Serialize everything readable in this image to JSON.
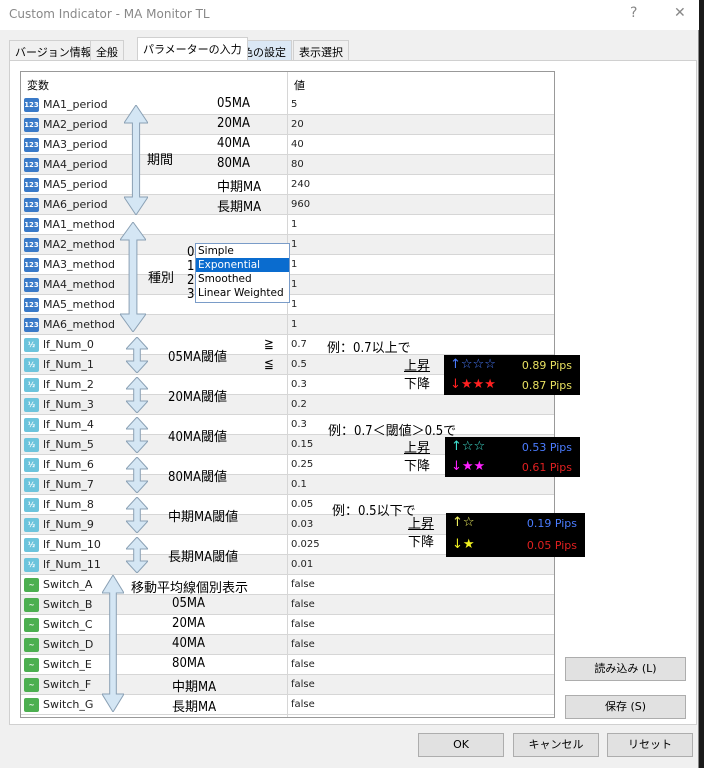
{
  "window": {
    "title": "Custom Indicator - MA Monitor TL",
    "help": "?",
    "close": "✕"
  },
  "tabs": [
    "バージョン情報",
    "全般",
    "パラメーターの入力",
    "色の設定",
    "表示選択"
  ],
  "grid": {
    "col_variable": "変数",
    "col_value": "値",
    "rows": [
      {
        "name": "MA1_period",
        "value": "5",
        "type": "int"
      },
      {
        "name": "MA2_period",
        "value": "20",
        "type": "int"
      },
      {
        "name": "MA3_period",
        "value": "40",
        "type": "int"
      },
      {
        "name": "MA4_period",
        "value": "80",
        "type": "int"
      },
      {
        "name": "MA5_period",
        "value": "240",
        "type": "int"
      },
      {
        "name": "MA6_period",
        "value": "960",
        "type": "int"
      },
      {
        "name": "MA1_method",
        "value": "1",
        "type": "int"
      },
      {
        "name": "MA2_method",
        "value": "1",
        "type": "int"
      },
      {
        "name": "MA3_method",
        "value": "1",
        "type": "int"
      },
      {
        "name": "MA4_method",
        "value": "1",
        "type": "int"
      },
      {
        "name": "MA5_method",
        "value": "1",
        "type": "int"
      },
      {
        "name": "MA6_method",
        "value": "1",
        "type": "int"
      },
      {
        "name": "lf_Num_0",
        "value": "0.7",
        "type": "dbl"
      },
      {
        "name": "lf_Num_1",
        "value": "0.5",
        "type": "dbl"
      },
      {
        "name": "lf_Num_2",
        "value": "0.3",
        "type": "dbl"
      },
      {
        "name": "lf_Num_3",
        "value": "0.2",
        "type": "dbl"
      },
      {
        "name": "lf_Num_4",
        "value": "0.3",
        "type": "dbl"
      },
      {
        "name": "lf_Num_5",
        "value": "0.15",
        "type": "dbl"
      },
      {
        "name": "lf_Num_6",
        "value": "0.25",
        "type": "dbl"
      },
      {
        "name": "lf_Num_7",
        "value": "0.1",
        "type": "dbl"
      },
      {
        "name": "lf_Num_8",
        "value": "0.05",
        "type": "dbl"
      },
      {
        "name": "lf_Num_9",
        "value": "0.03",
        "type": "dbl"
      },
      {
        "name": "lf_Num_10",
        "value": "0.025",
        "type": "dbl"
      },
      {
        "name": "lf_Num_11",
        "value": "0.01",
        "type": "dbl"
      },
      {
        "name": "Switch_A",
        "value": "false",
        "type": "bool"
      },
      {
        "name": "Switch_B",
        "value": "false",
        "type": "bool"
      },
      {
        "name": "Switch_C",
        "value": "false",
        "type": "bool"
      },
      {
        "name": "Switch_D",
        "value": "false",
        "type": "bool"
      },
      {
        "name": "Switch_E",
        "value": "false",
        "type": "bool"
      },
      {
        "name": "Switch_F",
        "value": "false",
        "type": "bool"
      },
      {
        "name": "Switch_G",
        "value": "false",
        "type": "bool"
      }
    ]
  },
  "icons": {
    "int": "123",
    "dbl": "½",
    "bool": "~"
  },
  "annotations": {
    "period_labels": [
      "05MA",
      "20MA",
      "40MA",
      "80MA",
      "中期MA",
      "長期MA"
    ],
    "period": "期間",
    "method": "種別",
    "method_numbers": [
      "0",
      "1",
      "2",
      "3"
    ],
    "method_options": [
      "Simple",
      "Exponential",
      "Smoothed",
      "Linear Weighted"
    ],
    "method_selected": "Exponential",
    "threshold_labels": [
      "05MA閾値",
      "20MA閾値",
      "40MA閾値",
      "80MA閾値",
      "中期MA閾値",
      "長期MA閾値"
    ],
    "gte": "≧",
    "lte": "≦",
    "examples": [
      {
        "text": "例：0.7以上で",
        "up": "上昇",
        "down": "下降",
        "up_stars": "↑☆☆☆",
        "down_stars": "↓★★★",
        "up_pips": "0.89 Pips",
        "down_pips": "0.87 Pips",
        "colors": {
          "up_stars": "#4a7cff",
          "down_stars": "#ff2020",
          "up_pips": "#e8e060",
          "down_pips": "#e8e060"
        }
      },
      {
        "text": "例：0.7＜閾値＞0.5で",
        "up": "上昇",
        "down": "下降",
        "up_stars": "↑☆☆",
        "down_stars": "↓★★",
        "up_pips": "0.53 Pips",
        "down_pips": "0.61 Pips",
        "colors": {
          "up_stars": "#40e0d0",
          "down_stars": "#ff20ff",
          "up_pips": "#4a7cff",
          "down_pips": "#e02020"
        }
      },
      {
        "text": "例：0.5以下で",
        "up": "上昇",
        "down": "下降",
        "up_stars": "↑☆",
        "down_stars": "↓★",
        "up_pips": "0.19 Pips",
        "down_pips": "0.05 Pips",
        "colors": {
          "up_stars": "#f0f060",
          "down_stars": "#f0f020",
          "up_pips": "#4a7cff",
          "down_pips": "#e02020"
        }
      }
    ],
    "switch_title": "移動平均線個別表示",
    "switch_labels": [
      "05MA",
      "20MA",
      "40MA",
      "80MA",
      "中期MA",
      "長期MA"
    ]
  },
  "buttons": {
    "load": "読み込み (L)",
    "save": "保存 (S)",
    "ok": "OK",
    "cancel": "キャンセル",
    "reset": "リセット"
  }
}
